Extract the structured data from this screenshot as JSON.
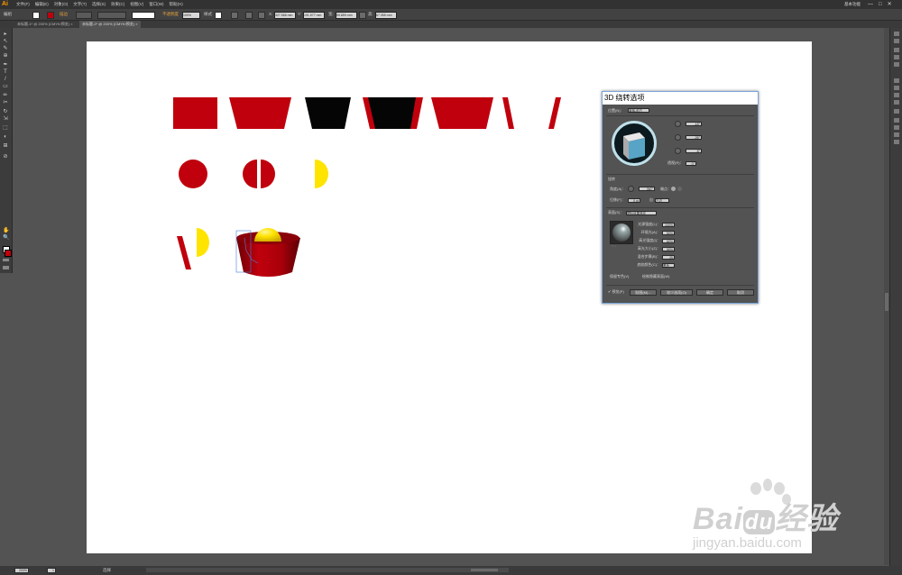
{
  "app": {
    "logo": "Ai",
    "menus": [
      "文件(F)",
      "编辑(E)",
      "对象(O)",
      "文字(T)",
      "选择(S)",
      "效果(C)",
      "视图(V)",
      "窗口(W)",
      "帮助(H)"
    ],
    "workspace": "基本功能",
    "window_buttons": [
      "—",
      "□",
      "✕"
    ]
  },
  "control_bar": {
    "selection_label": "编组",
    "opacity_label": "不透明度",
    "opacity_value": "100%",
    "style_label": "样式",
    "x_value": "327.566 mm",
    "y_value": "191.577 mm",
    "w_value": "59.859 mm",
    "h_value": "67.355 mm"
  },
  "tabs": [
    {
      "label": "未标题-1* @ 200% (CMYK/预览)",
      "close": "×"
    },
    {
      "label": "未标题-2* @ 200% (CMYK/预览)",
      "close": "×"
    }
  ],
  "toolbar": {
    "tools": [
      "▸",
      "↖",
      "✎",
      "⊕",
      "✒",
      "T",
      "/",
      "▭",
      "✏",
      "✂",
      "↻",
      "⇲",
      "⬚",
      "◐",
      "⊞",
      "⊘",
      "✋",
      "🔍"
    ]
  },
  "dialog": {
    "title": "3D 绕转选项",
    "position_label": "位置(N)：",
    "position_value": "离轴-前方",
    "x_rot": "-18°",
    "y_rot": "-26°",
    "z_rot": "8°",
    "perspective_label": "透视(R)：",
    "perspective_value": "0°",
    "revolve_label": "绕转",
    "angle_label": "角度(A)：",
    "angle_value": "360°",
    "cap_label": "端点：",
    "offset_label": "位移(F)：",
    "offset_value": "0 pt",
    "offset_from_label": "自",
    "offset_from_value": "左边",
    "surface_label": "表面(S)：",
    "surface_value": "塑料效果底纹",
    "light_intensity_label": "光源强度(L)：",
    "light_intensity_value": "100%",
    "ambient_label": "环境光(A)：",
    "ambient_value": "50%",
    "highlight_intensity_label": "高光强度(I)：",
    "highlight_intensity_value": "60%",
    "highlight_size_label": "高光大小(Z)：",
    "highlight_size_value": "90%",
    "blend_steps_label": "混合步骤(B)：",
    "blend_steps_value": "25",
    "shading_color_label": "底纹颜色(C)：",
    "shading_color_value": "黑色",
    "preserve_spot_label": "保留专色(V)",
    "draw_hidden_label": "绘制隐藏表面(W)",
    "preview_label": "✔ 预览(P)",
    "map_art_label": "贴图(M)...",
    "fewer_options_label": "较少选项(O)",
    "ok_label": "确定",
    "cancel_label": "取消"
  },
  "status": {
    "zoom": "200%",
    "page": "1",
    "tool": "选择"
  },
  "watermark": {
    "brand_left": "Bai",
    "brand_mid": "du",
    "brand_right": "经验",
    "url": "jingyan.baidu.com"
  },
  "colors": {
    "red": "#c0000d",
    "black": "#050505",
    "yellow": "#ffe400",
    "dark_red": "#8a0008"
  }
}
